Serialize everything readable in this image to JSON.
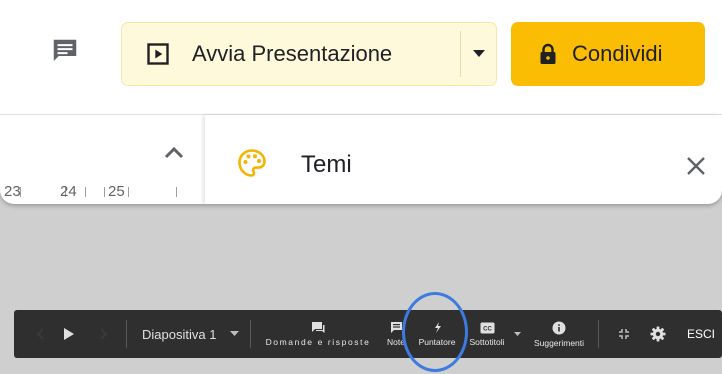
{
  "header": {
    "present_label": "Avvia Presentazione",
    "share_label": "Condividi"
  },
  "ruler": {
    "marks": [
      "23",
      "24",
      "25"
    ]
  },
  "themes_panel": {
    "title": "Temi"
  },
  "presenter_bar": {
    "slide_selector": "Diapositiva 1",
    "qa_label": "Domande e risposte",
    "notes_label": "Note",
    "pointer_label": "Puntatore",
    "captions_label": "Sottotitoli",
    "suggestions_label": "Suggerimenti",
    "exit_label": "ESCI"
  },
  "colors": {
    "share_button": "#fbbc04",
    "present_button": "#fff9dc",
    "presenter_bar": "#2f2f2f",
    "pointer_highlight": "#3d7be0",
    "palette_icon": "#f4b400"
  },
  "icons": {
    "comments": "comment-icon",
    "present": "play-box-icon",
    "present_menu": "caret-down-icon",
    "share": "lock-icon",
    "collapse": "chevron-up-icon",
    "themes": "palette-icon",
    "close": "close-icon"
  }
}
